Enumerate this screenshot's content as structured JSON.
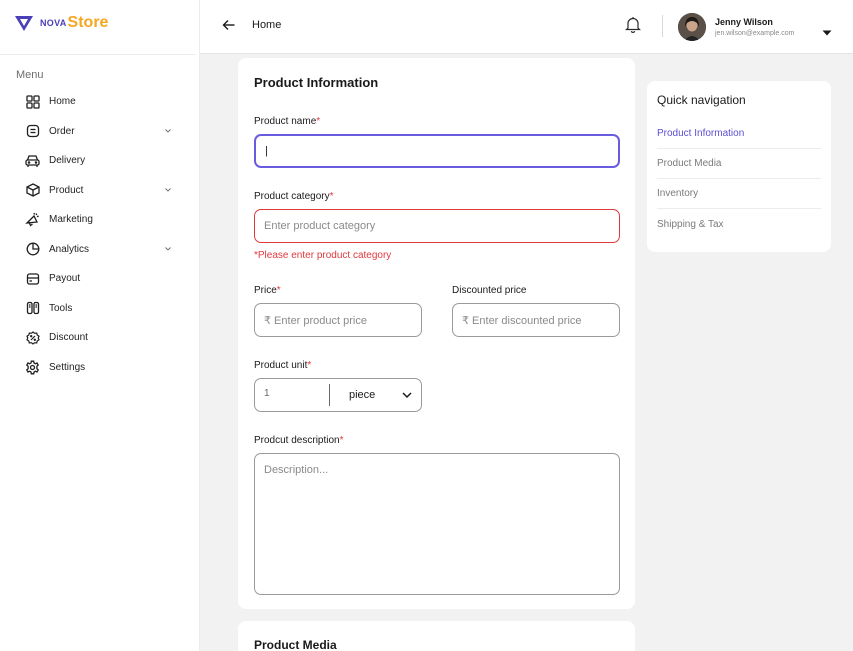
{
  "brand": {
    "prefix": "NOVA",
    "suffix": "Store"
  },
  "sidebar": {
    "menu_title": "Menu",
    "items": [
      {
        "label": "Home",
        "icon": "grid-icon",
        "expandable": false
      },
      {
        "label": "Order",
        "icon": "clipboard-icon",
        "expandable": true
      },
      {
        "label": "Delivery",
        "icon": "car-icon",
        "expandable": false
      },
      {
        "label": "Product",
        "icon": "box-icon",
        "expandable": true
      },
      {
        "label": "Marketing",
        "icon": "megaphone-icon",
        "expandable": false
      },
      {
        "label": "Analytics",
        "icon": "pie-chart-icon",
        "expandable": true
      },
      {
        "label": "Payout",
        "icon": "wallet-icon",
        "expandable": false
      },
      {
        "label": "Tools",
        "icon": "tools-icon",
        "expandable": false
      },
      {
        "label": "Discount",
        "icon": "discount-icon",
        "expandable": false
      },
      {
        "label": "Settings",
        "icon": "gear-icon",
        "expandable": false
      }
    ]
  },
  "header": {
    "title": "Home",
    "user": {
      "name": "Jenny Wilson",
      "email": "jen.wilson@example.com"
    }
  },
  "form": {
    "title": "Product Information",
    "product_name": {
      "label": "Product name",
      "required": "*",
      "value": "|"
    },
    "product_category": {
      "label": "Product category",
      "required": "*",
      "placeholder": "Enter product category",
      "error": "*Please enter product category"
    },
    "price": {
      "label": "Price",
      "required": "*",
      "placeholder": "₹ Enter product price"
    },
    "discounted_price": {
      "label": "Discounted price",
      "placeholder": "₹ Enter discounted price"
    },
    "product_unit": {
      "label": "Product unit",
      "required": "*",
      "value": "1",
      "unit": "piece"
    },
    "description": {
      "label": "Prodcut description",
      "required": "*",
      "placeholder": "Description..."
    }
  },
  "media": {
    "title": "Product Media"
  },
  "quick_nav": {
    "title": "Quick navigation",
    "items": [
      "Product Information",
      "Product Media",
      "Inventory",
      "Shipping  & Tax"
    ],
    "active_index": 0
  },
  "colors": {
    "accent": "#6a5ce0",
    "brand_purple": "#4b3fb8",
    "brand_orange": "#f5a623",
    "error": "#e0393e"
  }
}
